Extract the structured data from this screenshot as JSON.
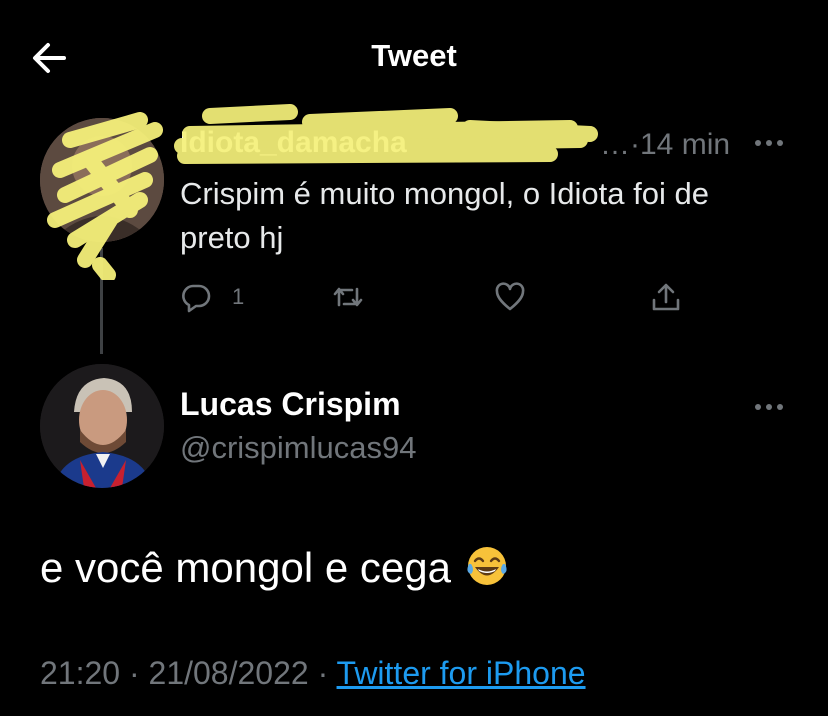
{
  "header": {
    "title": "Tweet"
  },
  "parent_tweet": {
    "name": "Idiota_damacha",
    "time": "14 min",
    "text": "Crispim é muito mongol, o Idiota foi de preto hj",
    "reply_count": "1"
  },
  "main_tweet": {
    "name": "Lucas Crispim",
    "handle": "@crispimlucas94",
    "text": "e você mongol e cega",
    "time": "21:20",
    "date": "21/08/2022",
    "source": "Twitter for iPhone"
  },
  "colors": {
    "background": "#000000",
    "text": "#e7e9ea",
    "secondary": "#71767b",
    "link": "#1d9bf0",
    "redaction": "#f5f07a"
  },
  "icons": [
    "back-arrow-icon",
    "more-icon",
    "reply-icon",
    "retweet-icon",
    "like-icon",
    "share-icon",
    "laughing-emoji-icon"
  ]
}
